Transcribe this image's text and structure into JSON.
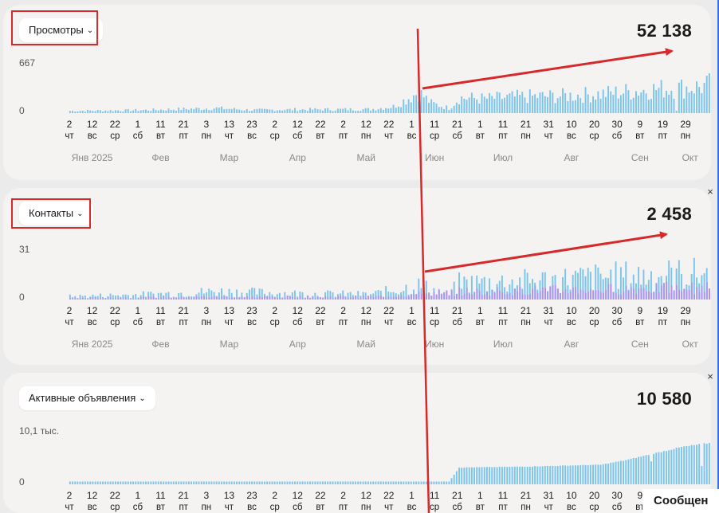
{
  "panels": [
    {
      "id": "views",
      "dropdown": "Просмотры",
      "total": "52 138",
      "ymax_label": "667",
      "ymin_label": "0",
      "top": 6,
      "height": 220,
      "chart_top": 86,
      "chart_h": 56,
      "dual": false,
      "close": ""
    },
    {
      "id": "contacts",
      "dropdown": "Контакты",
      "total": "2 458",
      "ymax_label": "31",
      "ymin_label": "0",
      "top": 236,
      "height": 222,
      "chart_top": 320,
      "chart_h": 56,
      "dual": true,
      "close": "×"
    },
    {
      "id": "ads",
      "dropdown": "Активные объявления",
      "total": "10 580",
      "ymax_label": "10,1 тыс.",
      "ymin_label": "0",
      "top": 468,
      "height": 176,
      "chart_top": 548,
      "chart_h": 60,
      "dual": false,
      "close": "×"
    }
  ],
  "ticks": [
    {
      "d": "2",
      "w": "чт"
    },
    {
      "d": "12",
      "w": "вс"
    },
    {
      "d": "22",
      "w": "ср"
    },
    {
      "d": "1",
      "w": "сб"
    },
    {
      "d": "11",
      "w": "вт"
    },
    {
      "d": "21",
      "w": "пт"
    },
    {
      "d": "3",
      "w": "пн"
    },
    {
      "d": "13",
      "w": "чт"
    },
    {
      "d": "23",
      "w": "вс"
    },
    {
      "d": "2",
      "w": "ср"
    },
    {
      "d": "12",
      "w": "сб"
    },
    {
      "d": "22",
      "w": "вт"
    },
    {
      "d": "2",
      "w": "пт"
    },
    {
      "d": "12",
      "w": "пн"
    },
    {
      "d": "22",
      "w": "чт"
    },
    {
      "d": "1",
      "w": "вс"
    },
    {
      "d": "11",
      "w": "ср"
    },
    {
      "d": "21",
      "w": "сб"
    },
    {
      "d": "1",
      "w": "вт"
    },
    {
      "d": "11",
      "w": "пт"
    },
    {
      "d": "21",
      "w": "пн"
    },
    {
      "d": "31",
      "w": "чт"
    },
    {
      "d": "10",
      "w": "вс"
    },
    {
      "d": "20",
      "w": "ср"
    },
    {
      "d": "30",
      "w": "сб"
    },
    {
      "d": "9",
      "w": "вт"
    },
    {
      "d": "19",
      "w": "пт"
    },
    {
      "d": "29",
      "w": "пн"
    }
  ],
  "months": [
    {
      "label": "Янв 2025",
      "tick": 1
    },
    {
      "label": "Фев",
      "tick": 4
    },
    {
      "label": "Мар",
      "tick": 7
    },
    {
      "label": "Апр",
      "tick": 10
    },
    {
      "label": "Май",
      "tick": 13
    },
    {
      "label": "Июн",
      "tick": 16
    },
    {
      "label": "Июл",
      "tick": 19
    },
    {
      "label": "Авг",
      "tick": 22
    },
    {
      "label": "Сен",
      "tick": 25
    },
    {
      "label": "Окт",
      "tick": 27.2
    }
  ],
  "chart_data": [
    {
      "type": "bar",
      "title": "Просмотры",
      "total": "52 138",
      "ylim": [
        0,
        667
      ],
      "x_range": [
        "2025-01-02",
        "2025-10-04"
      ],
      "series": [
        {
          "values": [
            {
              "x": "2025-01-02",
              "y": 40
            },
            {
              "x": "2025-02-01",
              "y": 55
            },
            {
              "x": "2025-03-01",
              "y": 90
            },
            {
              "x": "2025-03-15",
              "y": 55
            },
            {
              "x": "2025-04-01",
              "y": 65
            },
            {
              "x": "2025-05-01",
              "y": 70
            },
            {
              "x": "2025-05-10",
              "y": 120
            },
            {
              "x": "2025-05-20",
              "y": 380
            },
            {
              "x": "2025-05-25",
              "y": 180
            },
            {
              "x": "2025-06-01",
              "y": 90
            },
            {
              "x": "2025-06-05",
              "y": 280
            },
            {
              "x": "2025-06-15",
              "y": 260
            },
            {
              "x": "2025-07-01",
              "y": 300
            },
            {
              "x": "2025-07-15",
              "y": 310
            },
            {
              "x": "2025-08-01",
              "y": 350
            },
            {
              "x": "2025-08-20",
              "y": 430
            },
            {
              "x": "2025-09-09",
              "y": 480
            },
            {
              "x": "2025-09-20",
              "y": 600
            },
            {
              "x": "2025-09-25",
              "y": 660
            },
            {
              "x": "2025-10-04",
              "y": 450
            }
          ]
        }
      ]
    },
    {
      "type": "bar",
      "title": "Контакты",
      "total": "2 458",
      "ylim": [
        0,
        31
      ],
      "x_range": [
        "2025-01-02",
        "2025-10-04"
      ],
      "series": [
        {
          "values": [
            {
              "x": "2025-01-02",
              "y": 3
            },
            {
              "x": "2025-02-01",
              "y": 5
            },
            {
              "x": "2025-03-01",
              "y": 8
            },
            {
              "x": "2025-04-01",
              "y": 6
            },
            {
              "x": "2025-05-01",
              "y": 5
            },
            {
              "x": "2025-05-20",
              "y": 14
            },
            {
              "x": "2025-06-01",
              "y": 5
            },
            {
              "x": "2025-06-05",
              "y": 16
            },
            {
              "x": "2025-07-01",
              "y": 18
            },
            {
              "x": "2025-08-01",
              "y": 22
            },
            {
              "x": "2025-08-20",
              "y": 24
            },
            {
              "x": "2025-09-09",
              "y": 25
            },
            {
              "x": "2025-09-20",
              "y": 30
            },
            {
              "x": "2025-10-04",
              "y": 20
            }
          ]
        },
        {
          "values": [
            {
              "x": "2025-01-02",
              "y": 1
            },
            {
              "x": "2025-03-01",
              "y": 2
            },
            {
              "x": "2025-05-01",
              "y": 2
            },
            {
              "x": "2025-06-05",
              "y": 6
            },
            {
              "x": "2025-07-01",
              "y": 7
            },
            {
              "x": "2025-08-01",
              "y": 8
            },
            {
              "x": "2025-09-01",
              "y": 9
            },
            {
              "x": "2025-10-04",
              "y": 9
            }
          ]
        }
      ]
    },
    {
      "type": "bar",
      "title": "Активные объявления",
      "total": "10 580",
      "ylim": [
        0,
        10100
      ],
      "x_range": [
        "2025-01-02",
        "2025-10-04"
      ],
      "series": [
        {
          "values": [
            {
              "x": "2025-01-02",
              "y": 600
            },
            {
              "x": "2025-06-01",
              "y": 600
            },
            {
              "x": "2025-06-05",
              "y": 3600
            },
            {
              "x": "2025-07-01",
              "y": 3800
            },
            {
              "x": "2025-07-31",
              "y": 4200
            },
            {
              "x": "2025-08-10",
              "y": 5200
            },
            {
              "x": "2025-09-01",
              "y": 8000
            },
            {
              "x": "2025-10-04",
              "y": 10580
            }
          ]
        }
      ]
    }
  ],
  "footer": {
    "message_label": "Сообщен"
  },
  "colors": {
    "bar": "#7ac4ec",
    "bar_secondary": "#b78bf0",
    "annotation": "#d62a2a",
    "panel_bg": "#f4f3f2"
  }
}
